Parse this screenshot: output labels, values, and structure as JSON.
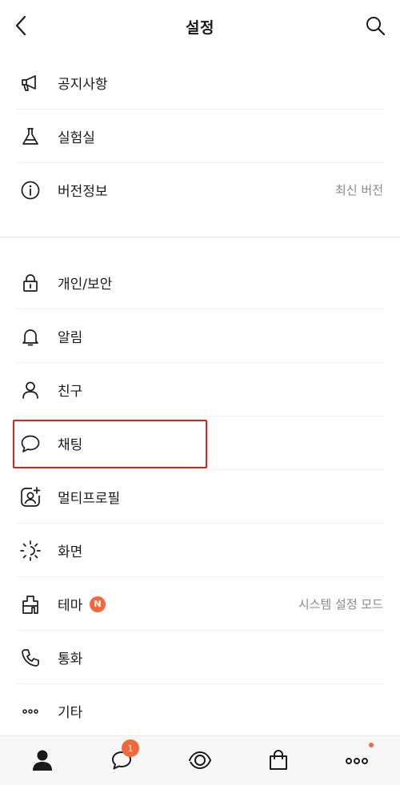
{
  "header": {
    "title": "설정"
  },
  "groups": [
    {
      "items": [
        {
          "label": "공지사항",
          "icon": "megaphone-icon"
        },
        {
          "label": "실험실",
          "icon": "flask-icon"
        },
        {
          "label": "버전정보",
          "icon": "info-icon",
          "value": "최신 버전"
        }
      ]
    },
    {
      "items": [
        {
          "label": "개인/보안",
          "icon": "lock-icon"
        },
        {
          "label": "알림",
          "icon": "bell-icon"
        },
        {
          "label": "친구",
          "icon": "person-icon"
        },
        {
          "label": "채팅",
          "icon": "chat-bubble-icon"
        },
        {
          "label": "멀티프로필",
          "icon": "multi-profile-icon"
        },
        {
          "label": "화면",
          "icon": "brightness-icon"
        },
        {
          "label": "테마",
          "icon": "theme-icon",
          "badge": "N",
          "value": "시스템 설정 모드"
        },
        {
          "label": "통화",
          "icon": "phone-icon"
        },
        {
          "label": "기타",
          "icon": "more-dots-icon"
        }
      ]
    }
  ],
  "bottom_nav": [
    {
      "icon": "friends-person-icon",
      "active": true
    },
    {
      "icon": "chat-icon",
      "badge": "1"
    },
    {
      "icon": "view-eye-icon"
    },
    {
      "icon": "shopping-bag-icon"
    },
    {
      "icon": "more-icon",
      "dot": true
    }
  ],
  "colors": {
    "accent": "#f2683a",
    "highlight_box": "#e0201e",
    "value_text": "#8a8a8a"
  }
}
